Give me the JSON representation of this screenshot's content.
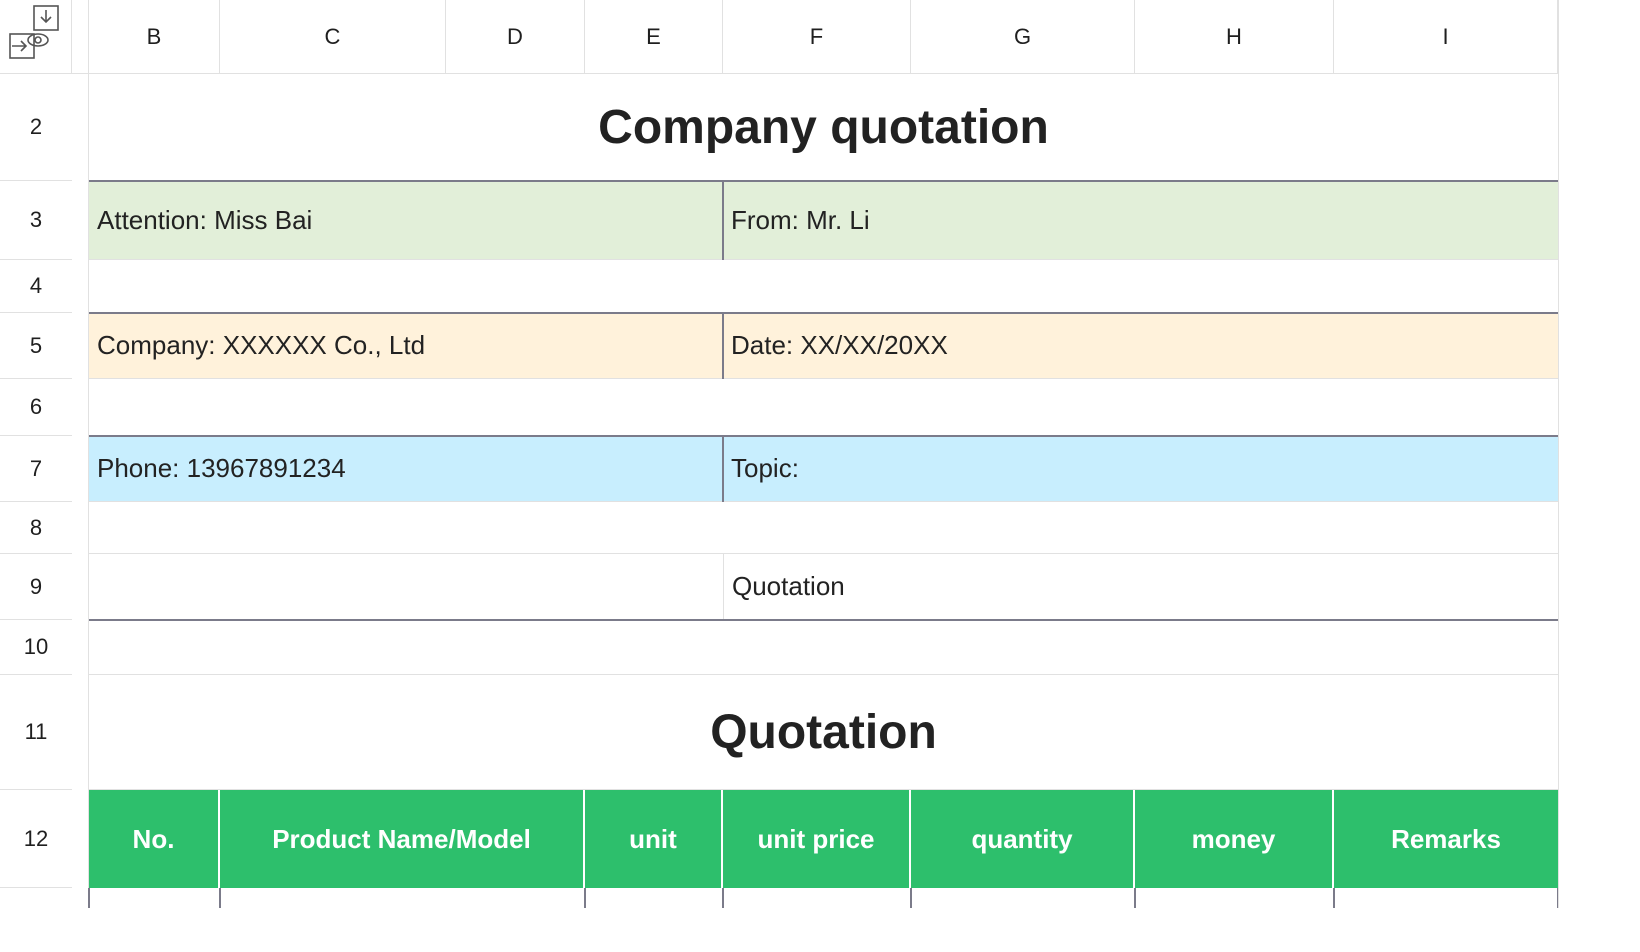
{
  "columns": [
    "B",
    "C",
    "D",
    "E",
    "F",
    "G",
    "H",
    "I"
  ],
  "rows": [
    "2",
    "3",
    "4",
    "5",
    "6",
    "7",
    "8",
    "9",
    "10",
    "11",
    "12"
  ],
  "corner_icon": "freeze-panes-icon",
  "sheet": {
    "title": "Company quotation",
    "attention": "Attention: Miss Bai",
    "from": "From: Mr. Li",
    "company": "Company: XXXXXX Co., Ltd",
    "date": "Date: XX/XX/20XX",
    "phone": "Phone: 13967891234",
    "topic": "Topic:",
    "quotation_label": "Quotation",
    "section_title": "Quotation",
    "table_headers": [
      "No.",
      "Product Name/Model",
      "unit",
      "unit price",
      "quantity",
      "money",
      "Remarks"
    ]
  },
  "colors": {
    "header_green": "#2dbf6c",
    "attention_bg": "#e2efd9",
    "company_bg": "#fff2db",
    "phone_bg": "#c8eefe"
  }
}
